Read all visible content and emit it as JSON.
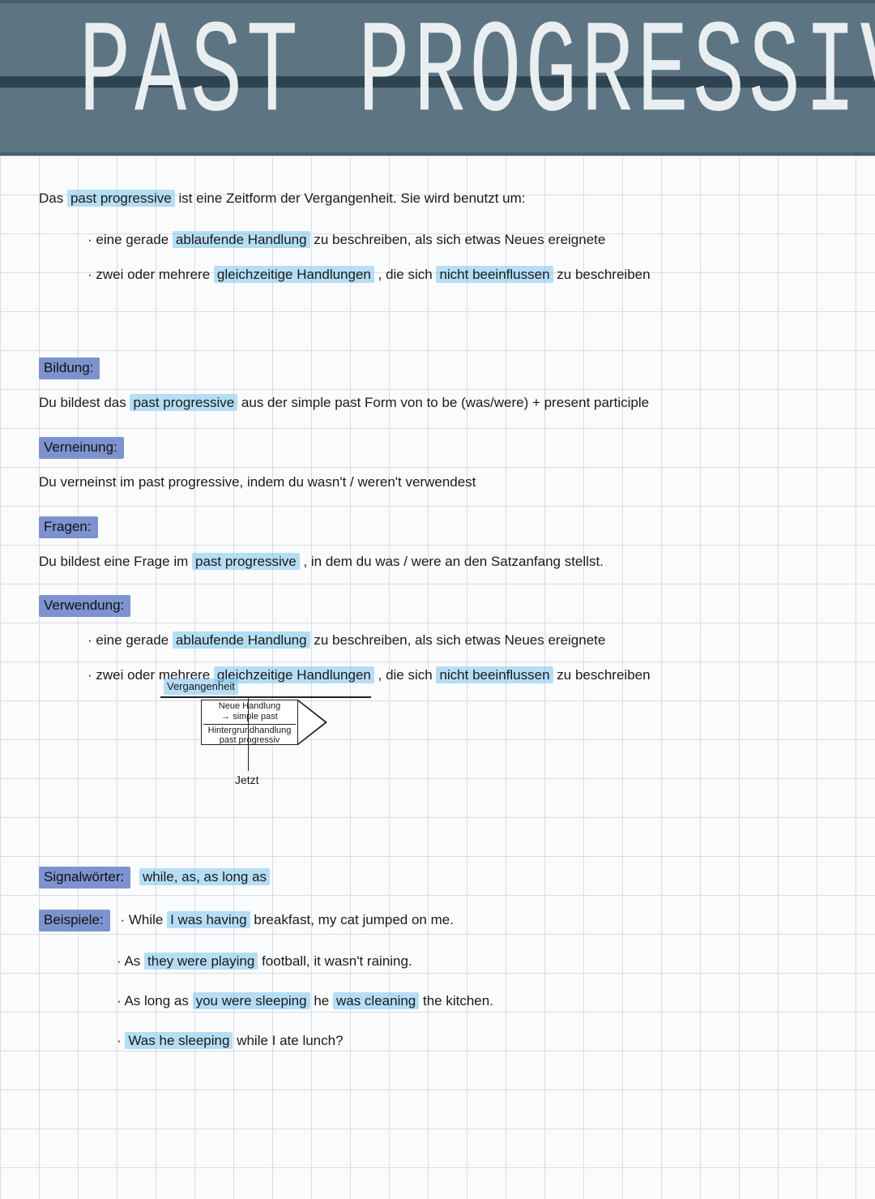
{
  "header": {
    "title": "PAST PROGRESSIVE"
  },
  "intro": {
    "pre": "Das ",
    "hl": "past progressive",
    "post": " ist eine Zeitform der Vergangenheit. Sie wird benutzt um:"
  },
  "bullets": {
    "b1a": "eine gerade ",
    "b1b": "ablaufende Handlung",
    "b1c": " zu beschreiben, als sich etwas Neues ereignete",
    "b2a": "zwei oder mehrere ",
    "b2b": "gleichzeitige Handlungen",
    "b2c": ", die sich ",
    "b2d": "nicht beeinflussen",
    "b2e": " zu beschreiben"
  },
  "sections": {
    "bildung": {
      "label": "Bildung:",
      "text_a": "Du bildest das ",
      "text_hl": "past progressive",
      "text_b": " aus der simple past Form von to be (was/were) + present participle"
    },
    "verneinung": {
      "label": "Verneinung:",
      "text": "Du verneinst im past progressive, indem du wasn't / weren't verwendest"
    },
    "fragen": {
      "label": "Fragen:",
      "text_a": "Du bildest eine Frage im ",
      "text_hl": "past progressive",
      "text_b": ", in dem du was / were an den Satzanfang stellst."
    },
    "verwendung": {
      "label": "Verwendung:"
    }
  },
  "diagram": {
    "vergangenheit": "Vergangenheit",
    "box_line1": "Neue Handlung",
    "box_line2": "→ simple past",
    "box_line3": "Hintergrundhandlung",
    "box_line4": "past progressiv",
    "jetzt": "Jetzt"
  },
  "signal": {
    "label": "Signalwörter:",
    "text": "while, as, as long as"
  },
  "beispiele": {
    "label": "Beispiele:",
    "e1a": "While ",
    "e1b": "I was having",
    "e1c": " breakfast, my cat jumped on me.",
    "e2a": "As ",
    "e2b": "they were playing",
    "e2c": " football, it wasn't raining.",
    "e3a": "As long as ",
    "e3b": "you were sleeping",
    "e3c": " he ",
    "e3d": "was cleaning",
    "e3e": " the kitchen.",
    "e4a": "Was he sleeping",
    "e4b": " while I ate lunch?"
  }
}
